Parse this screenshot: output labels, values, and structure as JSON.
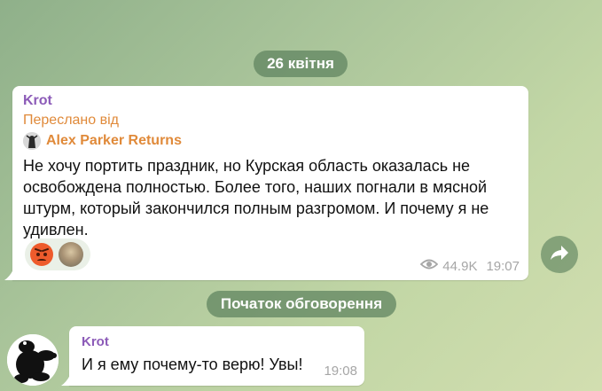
{
  "date_label": "26 квітня",
  "post": {
    "sender": "Krot",
    "forwarded_label": "Переслано від",
    "forwarded_from": "Alex Parker Returns",
    "text": "Не хочу портить праздник, но Курская область оказалась не освобождена полностью. Более того, наших погнали в мясной штурм, который закончился полным разгромом. И почему я не удивлен.",
    "reactions": [
      "angry-face",
      "user-avatar"
    ],
    "views": "44.9K",
    "time": "19:07"
  },
  "discussion_label": "Початок обговорення",
  "reply": {
    "sender": "Krot",
    "text": "И я ему почему-то верю! Увы!",
    "time": "19:08"
  },
  "colors": {
    "sender": "#8c5bb8",
    "forward": "#e08a3a",
    "pill_bg": "#608460",
    "meta": "#a6a6a6"
  }
}
